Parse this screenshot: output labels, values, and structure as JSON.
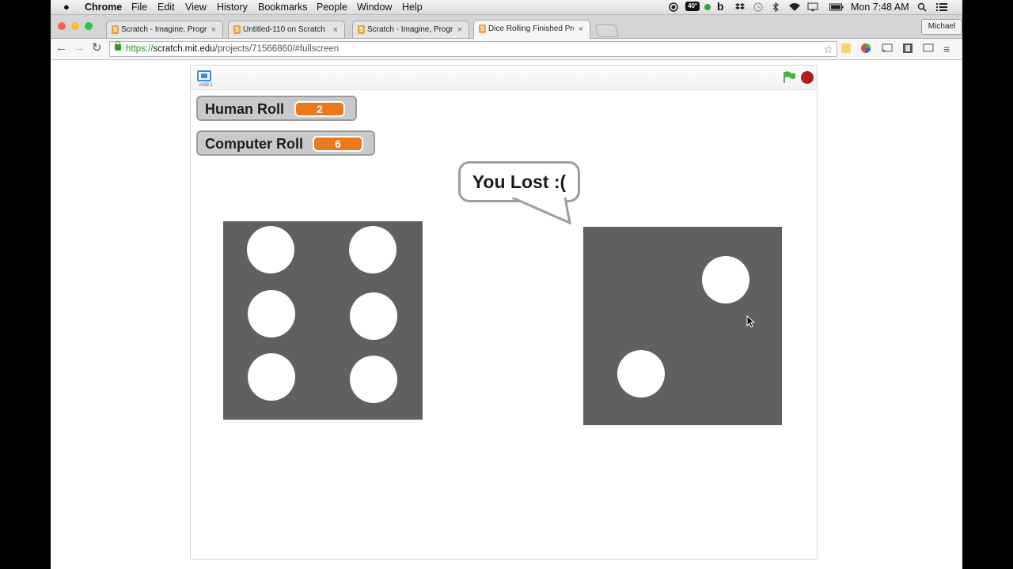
{
  "menubar": {
    "apple": "",
    "app_name": "Chrome",
    "menus": [
      "File",
      "Edit",
      "View",
      "History",
      "Bookmarks",
      "People",
      "Window",
      "Help"
    ],
    "temperature": "40°",
    "clock": "Mon 7:48 AM",
    "status_icons": [
      "record-icon",
      "weather-icon",
      "b-icon",
      "dropbox-icon",
      "time-machine-icon",
      "bluetooth-icon",
      "wifi-icon",
      "battery-icon",
      "spotlight-icon",
      "list-icon"
    ]
  },
  "tabs": [
    {
      "title": "Scratch - Imagine, Program",
      "close": "×",
      "active": false
    },
    {
      "title": "Untitled-110 on Scratch",
      "close": "×",
      "active": false
    },
    {
      "title": "Scratch - Imagine, Program",
      "close": "×",
      "active": false
    },
    {
      "title": "Dice Rolling Finished Proje",
      "close": "×",
      "active": true
    }
  ],
  "profile_name": "Michael",
  "toolbar": {
    "back": "←",
    "forward": "→",
    "reload": "↻",
    "url_scheme": "https://",
    "url_host": "scratch.mit.edu",
    "url_path": "/projects/71566860/#fullscreen",
    "bookmark_star": "☆",
    "menu": "≡"
  },
  "player": {
    "version": "v438.1",
    "monitors": [
      {
        "label": "Human Roll",
        "value": "2"
      },
      {
        "label": "Computer Roll",
        "value": "6"
      }
    ],
    "speech": "You Lost :(",
    "left_die_pips": 6,
    "right_die_pips": 2
  },
  "colors": {
    "die": "#606060",
    "monitor_value": "#e87a1d",
    "flag": "#3db83d",
    "stop": "#b01c1c",
    "secure_url": "#2a8f2a"
  }
}
